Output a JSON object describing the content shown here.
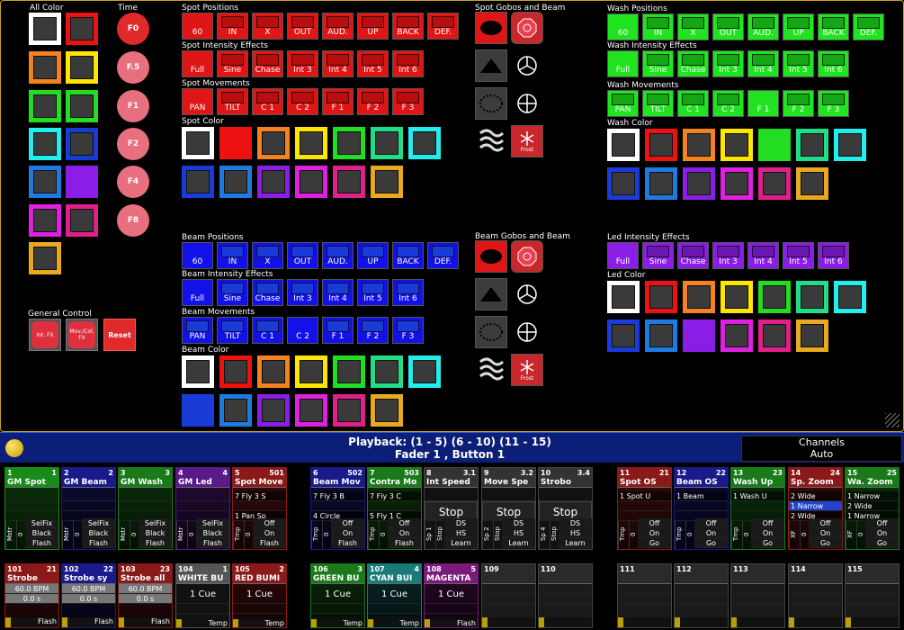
{
  "sections": {
    "all_color": "All Color",
    "time": "Time",
    "spot_positions": "Spot Positions",
    "spot_intensity": "Spot Intensity Effects",
    "spot_movements": "Spot Movements",
    "spot_color": "Spot Color",
    "spot_gobos": "Spot Gobos and Beam",
    "wash_positions": "Wash Positions",
    "wash_intensity": "Wash Intensity Effects",
    "wash_movements": "Wash Movements",
    "wash_color": "Wash Color",
    "beam_positions": "Beam Positions",
    "beam_intensity": "Beam Intensity Effects",
    "beam_movements": "Beam Movements",
    "beam_color": "Beam Color",
    "beam_gobos": "Beam Gobos and Beam",
    "led_intensity": "Led Intensity Effects",
    "led_color": "Led Color",
    "general_control": "General Control"
  },
  "time_buttons": [
    "F0",
    "F.5",
    "F1",
    "F2",
    "F4",
    "F8"
  ],
  "positions": [
    "60",
    "IN",
    "X",
    "OUT",
    "AUD.",
    "UP",
    "BACK",
    "DEF."
  ],
  "intensity": [
    "Full",
    "Sine",
    "Chase",
    "Int 3",
    "Int 4",
    "Int 5",
    "Int 6"
  ],
  "spot_movements": [
    "PAN",
    "TILT",
    "C 1",
    "C 2",
    "F 1",
    "F 2",
    "F 3"
  ],
  "wash_movements": [
    "PAN",
    "TILT",
    "C 1",
    "C 2",
    "F 1",
    "F 2",
    "F 3"
  ],
  "beam_movements": [
    "PAN",
    "TILT",
    "C 1",
    "C 2",
    "F 1",
    "F 2",
    "F 3"
  ],
  "frost_label": "Frost",
  "general_control": {
    "intfx": "Int. FX",
    "movfx": "Mov./Col. FX",
    "reset": "Reset"
  },
  "playback": {
    "line1": "Playback: (1 - 5) (6 - 10) (11 - 15)",
    "line2": "Fader  1 , Button  1",
    "channels": "Channels",
    "mode": "Auto"
  },
  "colors": {
    "accent": "#c4a222",
    "bar": "#0b1f78"
  },
  "exec_top": [
    {
      "num": "1",
      "type": "P",
      "idx": "1",
      "title": "GM Spot",
      "rows": [
        "",
        "",
        "",
        "SelFix",
        "Black",
        "Flash"
      ],
      "side": "Mstr",
      "sidev": "0",
      "color": "#1a8a1a"
    },
    {
      "num": "2",
      "type": "P",
      "idx": "2",
      "title": "GM Beam",
      "rows": [
        "",
        "",
        "",
        "SelFix",
        "Black",
        "Flash"
      ],
      "side": "Mstr",
      "sidev": "0",
      "color": "#1a1a8a"
    },
    {
      "num": "3",
      "type": "P",
      "idx": "3",
      "title": "GM Wash",
      "rows": [
        "",
        "",
        "",
        "SelFix",
        "Black",
        "Flash"
      ],
      "side": "Mstr",
      "sidev": "0",
      "color": "#1a7a1a"
    },
    {
      "num": "4",
      "type": "P",
      "idx": "4",
      "title": "GM Led",
      "rows": [
        "",
        "",
        "",
        "SelFix",
        "Black",
        "Flash"
      ],
      "side": "Mstr",
      "sidev": "0",
      "color": "#5a1a8a"
    },
    {
      "num": "5",
      "type": "L",
      "idx": "501",
      "title": "Spot Move",
      "rows": [
        "7 Fly 3 S",
        "",
        "1 Pan Sp",
        "Off",
        "On",
        "Flash"
      ],
      "side": "Tmp",
      "sidev": "0",
      "color": "#8a1a1a"
    },
    {
      "num": "6",
      "type": "L",
      "idx": "502",
      "title": "Beam Mov",
      "rows": [
        "7 Fly 3 B",
        "",
        "4 Circle",
        "Off",
        "On",
        "Flash"
      ],
      "side": "Tmp",
      "sidev": "0",
      "color": "#1a1a8a"
    },
    {
      "num": "7",
      "type": "L",
      "idx": "503",
      "title": "Contra Mo",
      "rows": [
        "7 Fly 3 C",
        "",
        "5 Fly 1 C",
        "Off",
        "On",
        "Flash"
      ],
      "side": "Tmp",
      "sidev": "0",
      "color": "#1a7a1a"
    },
    {
      "num": "8",
      "type": "Sp",
      "idx": "3.1",
      "title": "Int Speed",
      "rows": [
        "",
        "Stop",
        "",
        "DS",
        "HS",
        "Learn"
      ],
      "side": "Sp 1",
      "sidev": "Stop",
      "color": "#333"
    },
    {
      "num": "9",
      "type": "Sp",
      "idx": "3.2",
      "title": "Move Spe",
      "rows": [
        "",
        "Stop",
        "",
        "DS",
        "HS",
        "Learn"
      ],
      "side": "Sp 2",
      "sidev": "Stop",
      "color": "#333"
    },
    {
      "num": "10",
      "type": "Sp",
      "idx": "3.4",
      "title": "Strobo",
      "rows": [
        "",
        "Stop",
        "",
        "DS",
        "HS",
        "Learn"
      ],
      "side": "Sp 4",
      "sidev": "Stop",
      "color": "#333"
    },
    {
      "num": "11",
      "type": "LT",
      "idx": "21",
      "title": "Spot OS",
      "rows": [
        "1 Spot U",
        "",
        "",
        "Off",
        "On",
        "Go"
      ],
      "side": "Tmp",
      "sidev": "0",
      "color": "#8a1a1a"
    },
    {
      "num": "12",
      "type": "LT",
      "idx": "22",
      "title": "Beam OS",
      "rows": [
        "1 Beam",
        "",
        "",
        "Off",
        "On",
        "Go"
      ],
      "side": "Tmp",
      "sidev": "0",
      "color": "#1a1a8a"
    },
    {
      "num": "13",
      "type": "LT",
      "idx": "23",
      "title": "Wash Up",
      "rows": [
        "1 Wash U",
        "",
        "",
        "Off",
        "On",
        "Go"
      ],
      "side": "Tmp",
      "sidev": "0",
      "color": "#1a7a1a"
    },
    {
      "num": "14",
      "type": "LT",
      "idx": "24",
      "title": "Sp. Zoom",
      "rows": [
        "2 Wide",
        "1 Narrow",
        "2 Wide",
        "Off",
        "On",
        "Go"
      ],
      "side": "XF",
      "sidev": "0",
      "color": "#8a1a1a"
    },
    {
      "num": "15",
      "type": "LT",
      "idx": "25",
      "title": "Wa. Zoom",
      "rows": [
        "1 Narrow",
        "2 Wide",
        "1 Narrow",
        "Off",
        "On",
        "Go"
      ],
      "side": "XF",
      "sidev": "0",
      "color": "#1a7a1a"
    }
  ],
  "exec_bottom": [
    {
      "num": "101",
      "type": "LAS",
      "idx": "21",
      "title": "Strobe",
      "rows": [
        "60.0 BPM",
        "0.0 s"
      ],
      "foot": "Flash",
      "color": "#8a1a1a"
    },
    {
      "num": "102",
      "type": "LAS",
      "idx": "22",
      "title": "Strobe sy",
      "rows": [
        "60.0 BPM",
        "0.0 s"
      ],
      "foot": "Flash",
      "color": "#1a1a8a"
    },
    {
      "num": "103",
      "type": "LAS",
      "idx": "23",
      "title": "Strobe all",
      "rows": [
        "60.0 BPM",
        "0.0 s"
      ],
      "foot": "Flash",
      "color": "#8a1a1a"
    },
    {
      "num": "104",
      "type": "LT",
      "idx": "1",
      "title": "WHITE BU",
      "rows": [
        "1 Cue",
        ""
      ],
      "foot": "Temp",
      "color": "#555"
    },
    {
      "num": "105",
      "type": "LT",
      "idx": "2",
      "title": "RED BUMI",
      "rows": [
        "1 Cue",
        ""
      ],
      "foot": "Temp",
      "color": "#8a1a1a"
    },
    {
      "num": "106",
      "type": "LT",
      "idx": "3",
      "title": "GREEN BU",
      "rows": [
        "1 Cue",
        ""
      ],
      "foot": "Temp",
      "color": "#1a7a1a"
    },
    {
      "num": "107",
      "type": "LT",
      "idx": "4",
      "title": "CYAN BUI",
      "rows": [
        "1 Cue",
        ""
      ],
      "foot": "Temp",
      "color": "#1a7a7a"
    },
    {
      "num": "108",
      "type": "LT",
      "idx": "5",
      "title": "MAGENTA",
      "rows": [
        "1 Cue",
        ""
      ],
      "foot": "Flash",
      "color": "#7a1a7a"
    },
    {
      "num": "109",
      "type": "",
      "idx": "",
      "title": "",
      "rows": [
        "",
        ""
      ],
      "foot": "",
      "color": "#333"
    },
    {
      "num": "110",
      "type": "",
      "idx": "",
      "title": "",
      "rows": [
        "",
        ""
      ],
      "foot": "",
      "color": "#333"
    },
    {
      "num": "111",
      "type": "",
      "idx": "",
      "title": "",
      "rows": [
        "",
        ""
      ],
      "foot": "",
      "color": "#333"
    },
    {
      "num": "112",
      "type": "",
      "idx": "",
      "title": "",
      "rows": [
        "",
        ""
      ],
      "foot": "",
      "color": "#333"
    },
    {
      "num": "113",
      "type": "",
      "idx": "",
      "title": "",
      "rows": [
        "",
        ""
      ],
      "foot": "",
      "color": "#333"
    },
    {
      "num": "114",
      "type": "",
      "idx": "",
      "title": "",
      "rows": [
        "",
        ""
      ],
      "foot": "",
      "color": "#333"
    },
    {
      "num": "115",
      "type": "",
      "idx": "",
      "title": "",
      "rows": [
        "",
        ""
      ],
      "foot": "",
      "color": "#333"
    }
  ]
}
